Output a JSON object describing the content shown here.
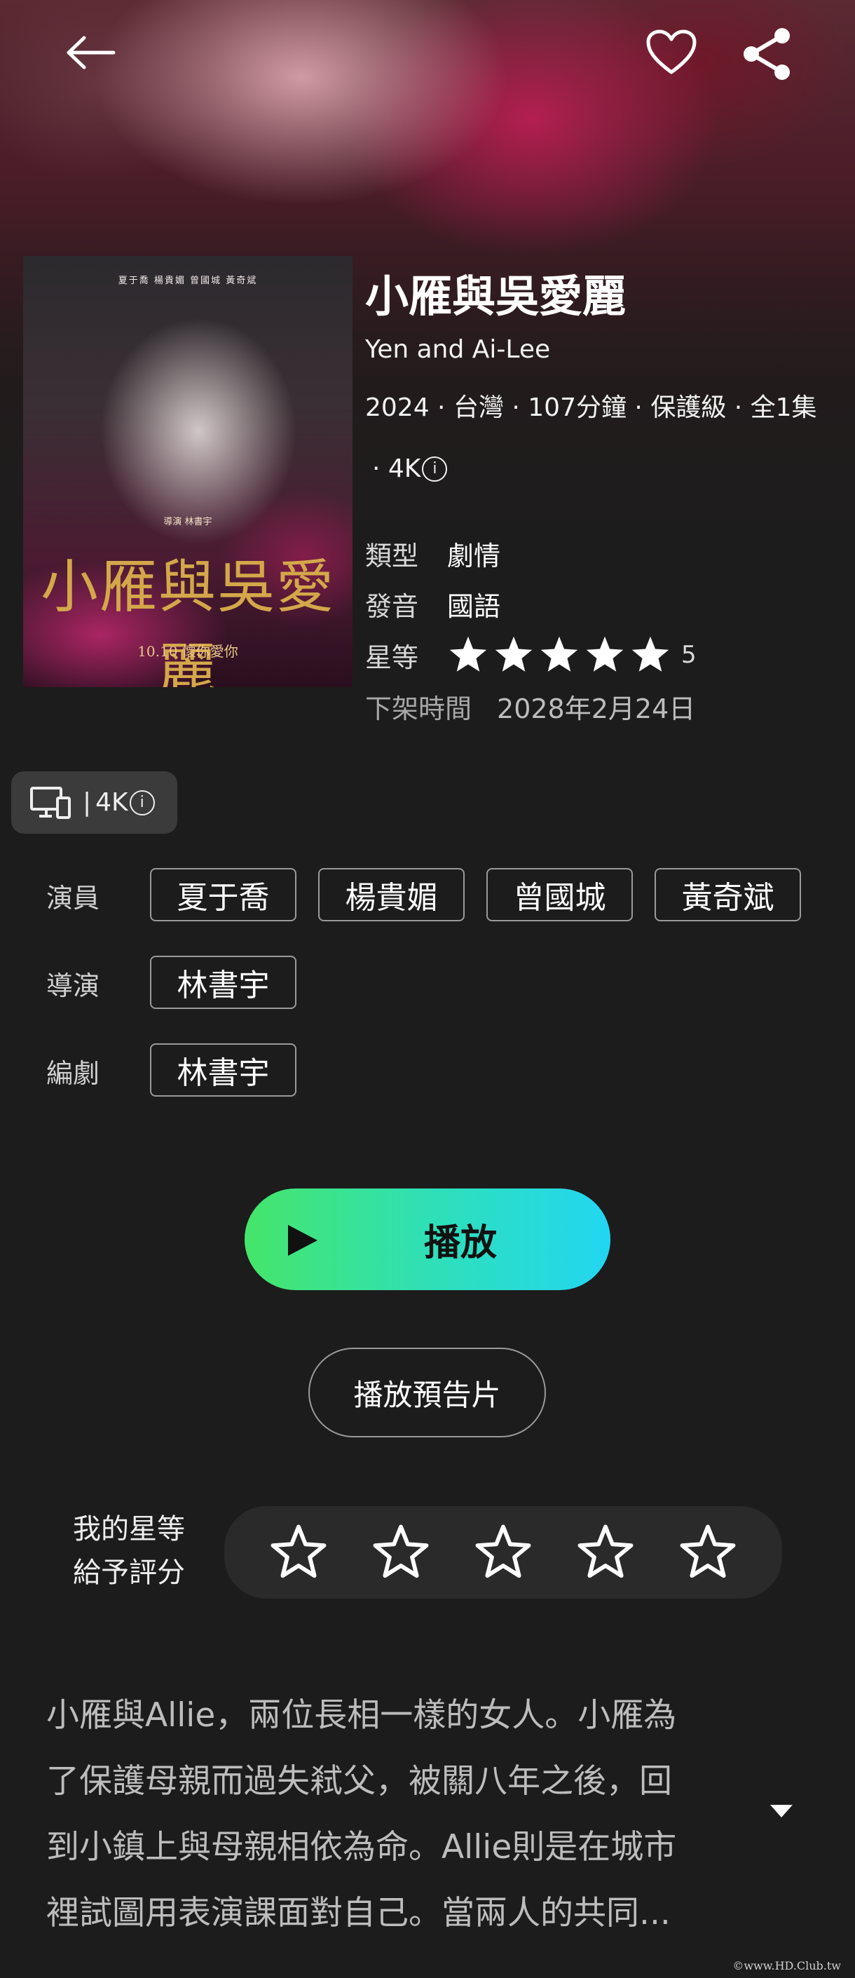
{
  "header": {
    "back_icon": "back-arrow-icon",
    "favorite_icon": "heart-icon",
    "share_icon": "share-icon"
  },
  "poster": {
    "credits": "夏于喬  楊貴媚  曾國城  黃奇斌",
    "director": "導演 林書宇",
    "title": "小雁與吳愛麗",
    "date": "10.10 懷你愛你"
  },
  "movie": {
    "title": "小雁與吳愛麗",
    "english_title": "Yen and Ai-Lee",
    "meta": "2024 · 台灣 · 107分鐘 · 保護級 · 全1集",
    "meta_quality": "· 4K",
    "info_glyph": "i",
    "genre_label": "類型",
    "genre": "劇情",
    "audio_label": "發音",
    "audio": "國語",
    "rating_label": "星等",
    "rating": 5,
    "rating_text": "5",
    "delist_label": "下架時間",
    "delist_date": "2028年2月24日"
  },
  "device": {
    "icon": "devices-icon",
    "separator": "|",
    "quality": "4K",
    "info_glyph": "i"
  },
  "credits": {
    "cast_label": "演員",
    "cast": [
      "夏于喬",
      "楊貴媚",
      "曾國城",
      "黃奇斌"
    ],
    "director_label": "導演",
    "director": "林書宇",
    "writer_label": "編劇",
    "writer": "林書宇"
  },
  "actions": {
    "play_label": "播放",
    "trailer_label": "播放預告片"
  },
  "my_rating": {
    "label_line1": "我的星等",
    "label_line2": "給予評分",
    "stars": 5,
    "value": 0
  },
  "synopsis": {
    "lines": [
      "小雁與Allie，兩位長相一樣的女人。小雁為",
      "了保護母親而過失弒父，被關八年之後，回",
      "到小鎮上與母親相依為命。Allie則是在城市",
      "裡試圖用表演課面對自己。當兩人的共同..."
    ],
    "expand_icon": "caret-down-icon"
  },
  "watermark": "©www.HD.Club.tw",
  "colors": {
    "background": "#1c1c1c",
    "play_gradient_start": "#45e56a",
    "play_gradient_end": "#22d6f2",
    "chip_border": "#9a9a9a"
  }
}
